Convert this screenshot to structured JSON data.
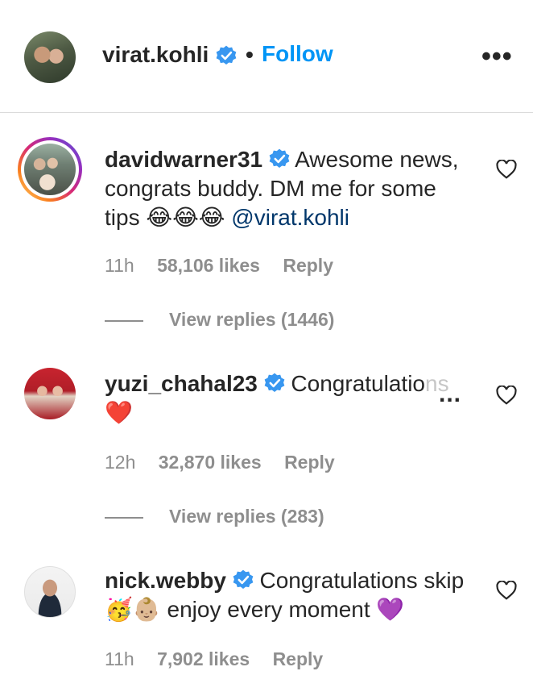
{
  "header": {
    "username": "virat.kohli",
    "separator": "•",
    "follow_label": "Follow",
    "more_label": "•••"
  },
  "comments": [
    {
      "username": "davidwarner31",
      "text": " Awesome news, congrats buddy. DM me for some tips ",
      "emoji": "😂😂😂",
      "mention": "@virat.kohli",
      "time": "11h",
      "likes": "58,106 likes",
      "reply": "Reply",
      "view_replies": "View replies (1446)"
    },
    {
      "username": "yuzi_chahal23",
      "text_visible": " Congratulatio",
      "text_faded": "ns",
      "ellipsis": "...",
      "emoji": "❤️",
      "time": "12h",
      "likes": "32,870 likes",
      "reply": "Reply",
      "view_replies": "View replies (283)"
    },
    {
      "username": "nick.webby",
      "text_a": " Congratulations skip ",
      "emoji_a": "🥳👶🏼",
      "text_b": " enjoy every moment ",
      "emoji_b": "💜",
      "time": "11h",
      "likes": "7,902 likes",
      "reply": "Reply"
    }
  ],
  "colors": {
    "accent": "#0095f6",
    "verified": "#3897f0",
    "secondary_text": "#8e8e8e",
    "mention": "#00376b"
  }
}
